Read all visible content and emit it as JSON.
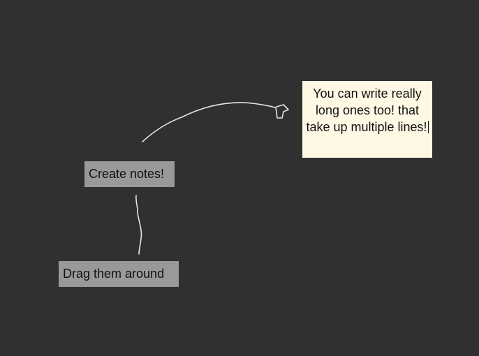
{
  "canvas": {
    "background": "#303030",
    "stroke_color": "#e6e6e6"
  },
  "notes": [
    {
      "id": "create",
      "text": "Create notes!",
      "background": "#999999"
    },
    {
      "id": "drag",
      "text": "Drag them around",
      "background": "#999999"
    },
    {
      "id": "long",
      "text": "You can write really long ones too! that take up multiple lines!",
      "background": "#fff8e4",
      "editing": true
    }
  ]
}
